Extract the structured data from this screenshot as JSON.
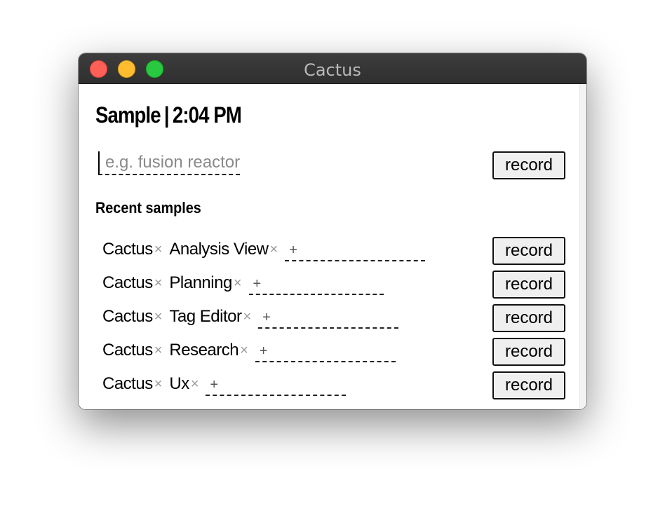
{
  "window": {
    "title": "Cactus"
  },
  "header": {
    "label": "Sample",
    "separator": "|",
    "time": "2:04 PM"
  },
  "new_sample": {
    "placeholder": "e.g. fusion reactor",
    "value": "",
    "record_label": "record"
  },
  "recent": {
    "title": "Recent samples",
    "rows": [
      {
        "tags": [
          "Cactus",
          "Analysis View"
        ],
        "add": "+",
        "record_label": "record"
      },
      {
        "tags": [
          "Cactus",
          "Planning"
        ],
        "add": "+",
        "record_label": "record"
      },
      {
        "tags": [
          "Cactus",
          "Tag Editor"
        ],
        "add": "+",
        "record_label": "record"
      },
      {
        "tags": [
          "Cactus",
          "Research"
        ],
        "add": "+",
        "record_label": "record"
      },
      {
        "tags": [
          "Cactus",
          "Ux"
        ],
        "add": "+",
        "record_label": "record"
      }
    ],
    "remove_glyph": "×"
  }
}
